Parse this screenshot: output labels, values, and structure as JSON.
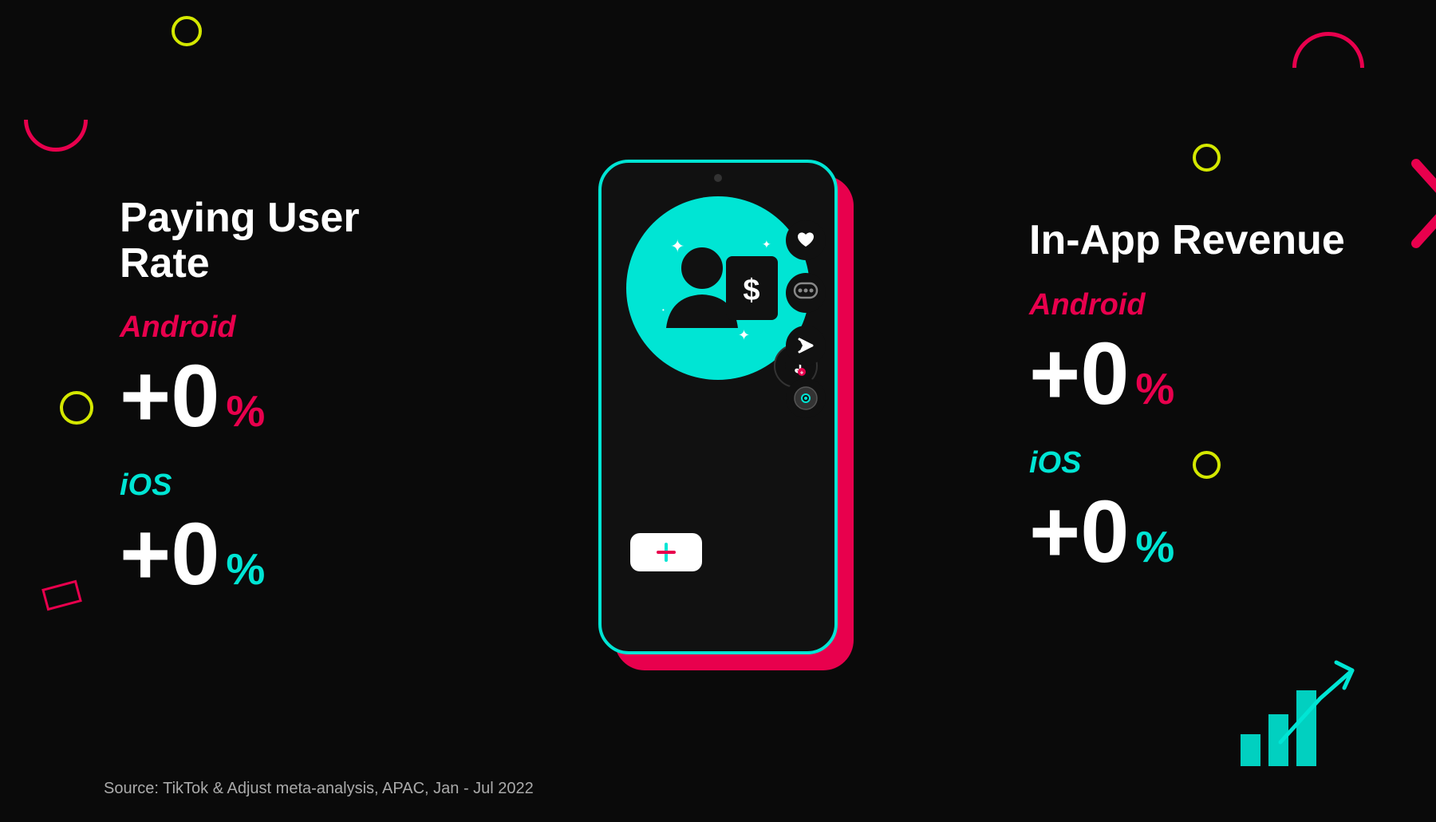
{
  "page": {
    "background": "#0a0a0a",
    "source_text": "Source: TikTok & Adjust meta-analysis, APAC, Jan - Jul 2022"
  },
  "left_section": {
    "title": "Paying User Rate",
    "android_label": "Android",
    "android_value": "+0",
    "android_percent": "%",
    "ios_label": "iOS",
    "ios_value": "+0",
    "ios_percent": "%"
  },
  "right_section": {
    "title": "In-App Revenue",
    "android_label": "Android",
    "android_value": "+0",
    "android_percent": "%",
    "ios_label": "iOS",
    "ios_value": "+0",
    "ios_percent": "%"
  },
  "decorative": {
    "colors": {
      "pink": "#e8004d",
      "cyan": "#00e5d4",
      "yellow": "#d4e800"
    }
  }
}
